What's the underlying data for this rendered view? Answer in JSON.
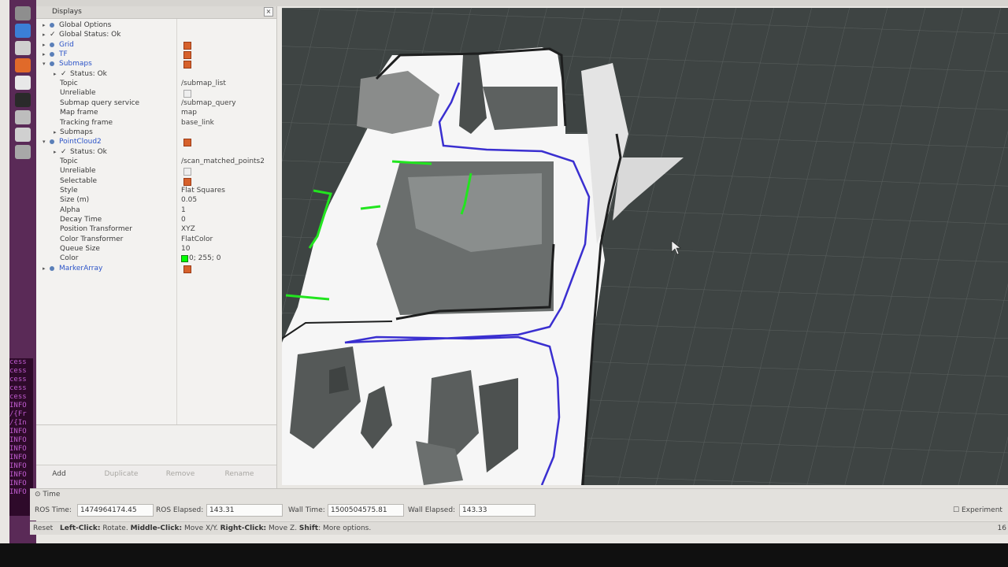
{
  "displays": {
    "title": "Displays",
    "close": "×",
    "rows": [
      {
        "type": "group",
        "label": "Global Options",
        "arrow": "▸"
      },
      {
        "type": "status",
        "label": "Global Status: Ok",
        "check": "✓",
        "arrow": "▸"
      },
      {
        "type": "plugin",
        "label": "Grid",
        "arrow": "▸",
        "checked": true
      },
      {
        "type": "plugin",
        "label": "TF",
        "arrow": "▸",
        "checked": true
      },
      {
        "type": "plugin",
        "label": "Submaps",
        "arrow": "▾",
        "checked": true
      },
      {
        "type": "status",
        "label": "Status: Ok",
        "check": "✓",
        "arrow": "▸"
      },
      {
        "type": "prop",
        "label": "Topic",
        "value": "/submap_list"
      },
      {
        "type": "propcb",
        "label": "Unreliable",
        "checked": false
      },
      {
        "type": "prop",
        "label": "Submap query service",
        "value": "/submap_query"
      },
      {
        "type": "prop",
        "label": "Map frame",
        "value": "map"
      },
      {
        "type": "prop",
        "label": "Tracking frame",
        "value": "base_link"
      },
      {
        "type": "prop",
        "label": "Submaps",
        "arrow": "▸"
      },
      {
        "type": "plugin",
        "label": "PointCloud2",
        "arrow": "▾",
        "checked": true
      },
      {
        "type": "status",
        "label": "Status: Ok",
        "check": "✓",
        "arrow": "▸"
      },
      {
        "type": "prop",
        "label": "Topic",
        "value": "/scan_matched_points2"
      },
      {
        "type": "propcb",
        "label": "Unreliable",
        "checked": false
      },
      {
        "type": "propcb",
        "label": "Selectable",
        "checked": true
      },
      {
        "type": "prop",
        "label": "Style",
        "value": "Flat Squares"
      },
      {
        "type": "prop",
        "label": "Size (m)",
        "value": "0.05"
      },
      {
        "type": "prop",
        "label": "Alpha",
        "value": "1"
      },
      {
        "type": "prop",
        "label": "Decay Time",
        "value": "0"
      },
      {
        "type": "prop",
        "label": "Position Transformer",
        "value": "XYZ"
      },
      {
        "type": "prop",
        "label": "Color Transformer",
        "value": "FlatColor"
      },
      {
        "type": "prop",
        "label": "Queue Size",
        "value": "10"
      },
      {
        "type": "propcolor",
        "label": "Color",
        "value": "0; 255; 0",
        "swatch": "#00ff00"
      },
      {
        "type": "plugin",
        "label": "MarkerArray",
        "arrow": "▸",
        "checked": true
      }
    ]
  },
  "buttons": {
    "add": "Add",
    "duplicate": "Duplicate",
    "remove": "Remove",
    "rename": "Rename"
  },
  "time": {
    "title": "Time",
    "ros_time_label": "ROS Time:",
    "ros_time": "1474964174.45",
    "ros_elapsed_label": "ROS Elapsed:",
    "ros_elapsed": "143.31",
    "wall_time_label": "Wall Time:",
    "wall_time": "1500504575.81",
    "wall_elapsed_label": "Wall Elapsed:",
    "wall_elapsed": "143.33",
    "experimental": "Experiment"
  },
  "status": {
    "reset": "Reset",
    "left": "Left-Click:",
    "left_t": " Rotate. ",
    "middle": "Middle-Click:",
    "middle_t": " Move X/Y. ",
    "right": "Right-Click:",
    "right_t": " Move Z. ",
    "shift": "Shift",
    "shift_t": ": More options.",
    "fps": "16"
  },
  "terminal_lines": [
    "cess",
    "cess",
    "cess",
    "cess",
    "cess",
    "INFO",
    "/{Fr",
    "/{In",
    "INFO",
    "INFO",
    "INFO",
    "INFO",
    "INFO",
    "INFO",
    "INFO",
    "INFO"
  ],
  "colors": {
    "pointcloud": "#00ff00",
    "trajectory": "#3a2fd0",
    "plugin_label": "#2c54c8"
  }
}
